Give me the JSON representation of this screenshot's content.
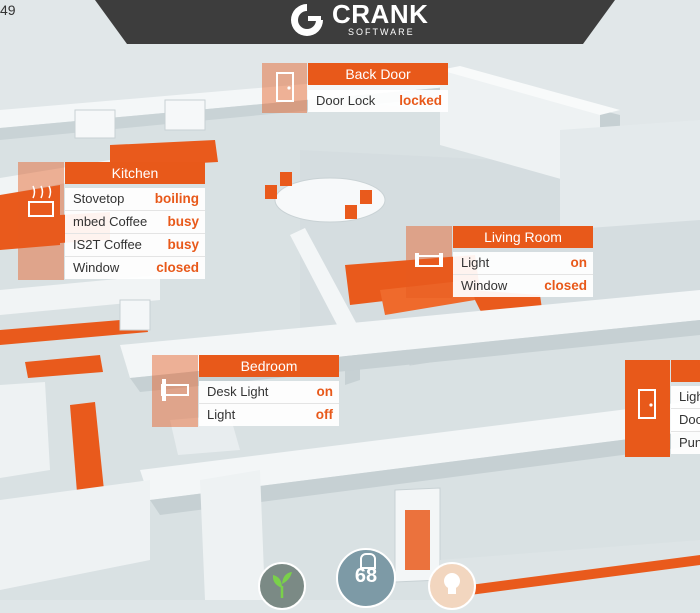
{
  "header": {
    "time_fragment": "49",
    "brand": "CRANK",
    "brand_sub": "SOFTWARE"
  },
  "rooms": {
    "back_door": {
      "title": "Back Door",
      "rows": [
        {
          "label": "Door Lock",
          "status": "locked"
        }
      ]
    },
    "kitchen": {
      "title": "Kitchen",
      "rows": [
        {
          "label": "Stovetop",
          "status": "boiling"
        },
        {
          "label": "mbed Coffee",
          "status": "busy"
        },
        {
          "label": "IS2T Coffee",
          "status": "busy"
        },
        {
          "label": "Window",
          "status": "closed"
        }
      ]
    },
    "living_room": {
      "title": "Living Room",
      "rows": [
        {
          "label": "Light",
          "status": "on"
        },
        {
          "label": "Window",
          "status": "closed"
        }
      ]
    },
    "bedroom": {
      "title": "Bedroom",
      "rows": [
        {
          "label": "Desk Light",
          "status": "on"
        },
        {
          "label": "Light",
          "status": "off"
        }
      ]
    },
    "front": {
      "rows": [
        {
          "label": "Ligh"
        },
        {
          "label": "Doo"
        },
        {
          "label": "Pun"
        }
      ]
    }
  },
  "bottom_bar": {
    "thermostat_value": "68"
  },
  "colors": {
    "accent": "#e8591a",
    "header_bg": "#3d3d3d",
    "floor": "#dfe6e8",
    "wall": "#f2f5f6"
  },
  "icons": [
    "crank-logo-icon",
    "door-icon",
    "kitchen-icon",
    "sofa-icon",
    "bed-icon",
    "front-door-icon",
    "plant-icon",
    "thermostat-icon",
    "bulb-icon"
  ]
}
